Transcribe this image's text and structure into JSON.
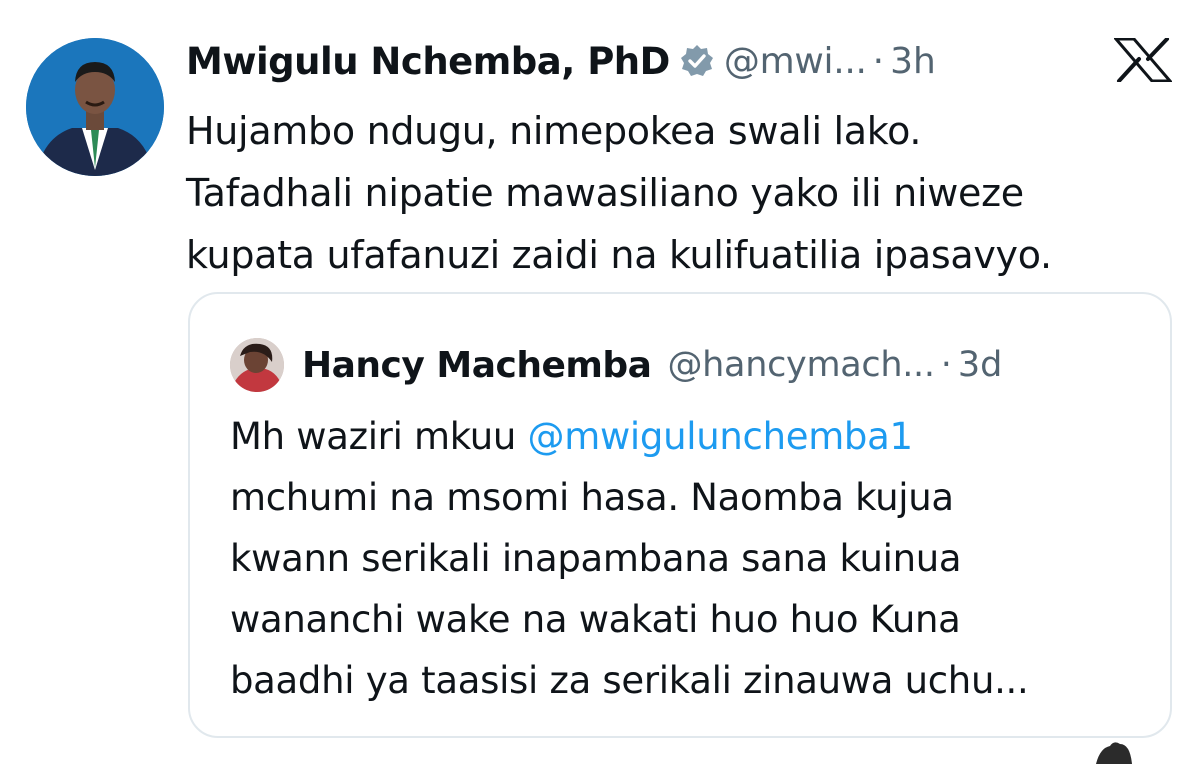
{
  "tweet": {
    "author_name": "Mwigulu Nchemba, PhD",
    "handle": "@mwi...",
    "separator": "·",
    "time": "3h",
    "text_lines": [
      "Hujambo ndugu, nimepokea swali lako.",
      "Tafadhali nipatie mawasiliano yako ili niweze",
      "kupata ufafanuzi zaidi na kulifuatilia ipasavyo."
    ]
  },
  "quote": {
    "author_name": "Hancy Machemba",
    "handle": "@hancymach...",
    "separator": "·",
    "time": "3d",
    "line1_prefix": "Mh waziri mkuu ",
    "mention": "@mwigulunchemba1",
    "text_lines": [
      "mchumi na msomi hasa. Naomba kujua",
      "kwann serikali inapambana sana kuinua",
      "wananchi wake na wakati huo huo Kuna",
      "baadhi ya taasisi za serikali zinauwa uchu..."
    ]
  },
  "icons": {
    "verified": "verified-badge-icon",
    "platform": "x-logo-icon"
  },
  "colors": {
    "text": "#0f1419",
    "secondary": "#536471",
    "link": "#1d9bf0",
    "border": "#e1e8ed",
    "avatar_bg": "#1a73b6"
  }
}
